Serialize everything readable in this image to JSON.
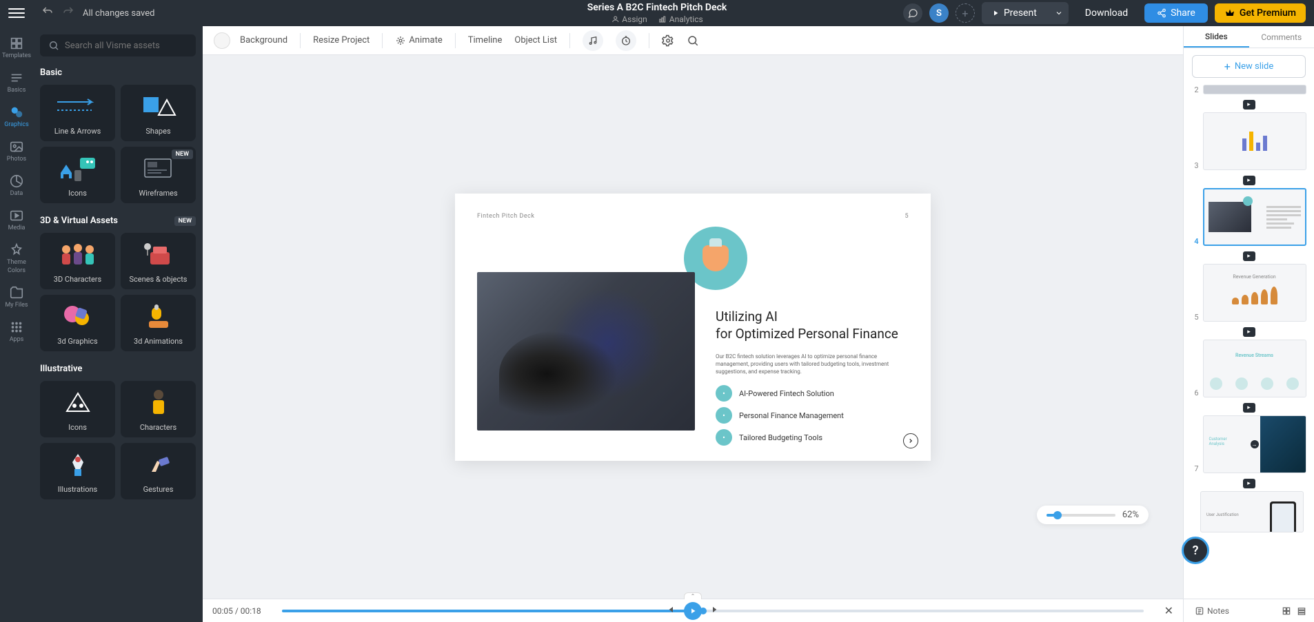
{
  "header": {
    "save_status": "All changes saved",
    "doc_title": "Series A B2C Fintech Pitch Deck",
    "assign": "Assign",
    "analytics": "Analytics",
    "avatar_initial": "S",
    "present": "Present",
    "download": "Download",
    "share": "Share",
    "premium": "Get Premium"
  },
  "nav": {
    "templates": "Templates",
    "basics": "Basics",
    "graphics": "Graphics",
    "photos": "Photos",
    "data": "Data",
    "media": "Media",
    "theme_colors_l1": "Theme",
    "theme_colors_l2": "Colors",
    "my_files": "My Files",
    "apps": "Apps"
  },
  "sidebar": {
    "search_placeholder": "Search all Visme assets",
    "sections": {
      "basic": "Basic",
      "3d": "3D & Virtual Assets",
      "illustrative": "Illustrative"
    },
    "new_badge": "NEW",
    "cards": {
      "line_arrows": "Line & Arrows",
      "shapes": "Shapes",
      "icons": "Icons",
      "wireframes": "Wireframes",
      "3d_characters": "3D Characters",
      "scenes_objects": "Scenes & objects",
      "3d_graphics": "3d Graphics",
      "3d_animations": "3d Animations",
      "ill_icons": "Icons",
      "characters": "Characters",
      "illustrations": "Illustrations",
      "gestures": "Gestures"
    }
  },
  "toolbar": {
    "background": "Background",
    "resize": "Resize Project",
    "animate": "Animate",
    "timeline": "Timeline",
    "object_list": "Object List"
  },
  "slide": {
    "deck_label": "Fintech Pitch Deck",
    "page_num": "5",
    "title_l1": "Utilizing AI",
    "title_l2": "for Optimized Personal Finance",
    "paragraph": "Our B2C fintech solution leverages AI to optimize personal finance management, providing users with tailored budgeting tools, investment suggestions, and expense tracking.",
    "features": [
      "AI-Powered Fintech Solution",
      "Personal Finance Management",
      "Tailored Budgeting Tools"
    ]
  },
  "zoom": {
    "value": "62%"
  },
  "timeline": {
    "current": "00:05",
    "total": "00:18"
  },
  "right_panel": {
    "tab_slides": "Slides",
    "tab_comments": "Comments",
    "new_slide": "New slide",
    "slide_nums": [
      "2",
      "3",
      "4",
      "5",
      "6",
      "7"
    ],
    "notes": "Notes"
  }
}
